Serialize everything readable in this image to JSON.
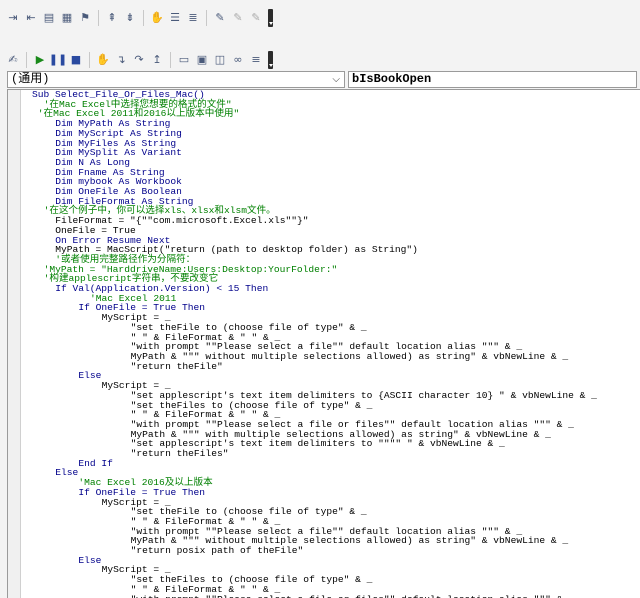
{
  "toolbar1": {
    "icons": [
      "indent-icon",
      "outdent-icon",
      "comment-icon",
      "uncomment-icon",
      "bookmark-icon",
      "prev-bookmark-icon",
      "next-bookmark-icon",
      "clear-bookmarks-icon",
      "hand-icon",
      "list-properties-icon",
      "list-constants-icon",
      "toggle-breakpoint-icon",
      "step-icon",
      "step-over-icon",
      "step-out-icon"
    ]
  },
  "toolbar2": {
    "icons": [
      "design-mode-icon",
      "run-icon",
      "break-icon",
      "reset-icon",
      "breakpoint-icon",
      "userform-icon",
      "project-explorer-icon",
      "properties-window-icon",
      "object-browser-icon",
      "toolbox-icon",
      "help-icon"
    ]
  },
  "object_combo": {
    "value": "(通用)"
  },
  "procedure_combo": {
    "value": "bIsBookOpen"
  },
  "code_lines": [
    {
      "i": 0,
      "t": "Sub Select_File_Or_Files_Mac()",
      "c": "kw"
    },
    {
      "i": 2,
      "t": "'在Mac Excel中选择您想要的格式的文件\"",
      "c": "cm"
    },
    {
      "i": 1,
      "t": "'在Mac Excel 2011和2016以上版本中使用\"",
      "c": "cm"
    },
    {
      "i": 4,
      "t": "Dim MyPath As String",
      "c": "kw"
    },
    {
      "i": 4,
      "t": "Dim MyScript As String",
      "c": "kw"
    },
    {
      "i": 4,
      "t": "Dim MyFiles As String",
      "c": "kw"
    },
    {
      "i": 4,
      "t": "Dim MySplit As Variant",
      "c": "kw"
    },
    {
      "i": 4,
      "t": "Dim N As Long",
      "c": "kw"
    },
    {
      "i": 4,
      "t": "Dim Fname As String",
      "c": "kw"
    },
    {
      "i": 4,
      "t": "Dim mybook As Workbook",
      "c": "kw"
    },
    {
      "i": 4,
      "t": "Dim OneFile As Boolean",
      "c": "kw"
    },
    {
      "i": 4,
      "t": "Dim FileFormat As String",
      "c": "kw"
    },
    {
      "i": 2,
      "t": "'在这个例子中，你可以选择xls、xlsx和xlsm文件。",
      "c": "cm"
    },
    {
      "i": 4,
      "t": "FileFormat = \"{\"\"com.microsoft.Excel.xls\"\"}\"",
      "c": ""
    },
    {
      "i": 4,
      "t": "OneFile = True",
      "c": ""
    },
    {
      "i": 4,
      "t": "On Error Resume Next",
      "c": "kw"
    },
    {
      "i": 4,
      "t": "MyPath = MacScript(\"return (path to desktop folder) as String\")",
      "c": ""
    },
    {
      "i": 4,
      "t": "'或者使用完整路径作为分隔符：",
      "c": "cm"
    },
    {
      "i": 2,
      "t": "'MyPath = \"HarddriveName:Users:Desktop:YourFolder:\"",
      "c": "cm"
    },
    {
      "i": 2,
      "t": "'构建applescript字符串，不要改变它",
      "c": "cm"
    },
    {
      "i": 4,
      "t": "If Val(Application.Version) < 15 Then",
      "c": "kw"
    },
    {
      "i": 10,
      "t": "'Mac Excel 2011",
      "c": "cm"
    },
    {
      "i": 8,
      "t": "If OneFile = True Then",
      "c": "kw"
    },
    {
      "i": 12,
      "t": "MyScript = _",
      "c": ""
    },
    {
      "i": 17,
      "t": "\"set theFile to (choose file of type\" & _",
      "c": ""
    },
    {
      "i": 17,
      "t": "\" \" & FileFormat & \" \" & _",
      "c": ""
    },
    {
      "i": 17,
      "t": "\"with prompt \"\"Please select a file\"\" default location alias \"\"\" & _",
      "c": ""
    },
    {
      "i": 17,
      "t": "MyPath & \"\"\" without multiple selections allowed) as string\" & vbNewLine & _",
      "c": ""
    },
    {
      "i": 17,
      "t": "\"return theFile\"",
      "c": ""
    },
    {
      "i": 8,
      "t": "Else",
      "c": "kw"
    },
    {
      "i": 12,
      "t": "MyScript = _",
      "c": ""
    },
    {
      "i": 17,
      "t": "\"set applescript's text item delimiters to {ASCII character 10} \" & vbNewLine & _",
      "c": ""
    },
    {
      "i": 17,
      "t": "\"set theFiles to (choose file of type\" & _",
      "c": ""
    },
    {
      "i": 17,
      "t": "\" \" & FileFormat & \" \" & _",
      "c": ""
    },
    {
      "i": 17,
      "t": "\"with prompt \"\"Please select a file or files\"\" default location alias \"\"\" & _",
      "c": ""
    },
    {
      "i": 17,
      "t": "MyPath & \"\"\" with multiple selections allowed) as string\" & vbNewLine & _",
      "c": ""
    },
    {
      "i": 17,
      "t": "\"set applescript's text item delimiters to \"\"\"\" \" & vbNewLine & _",
      "c": ""
    },
    {
      "i": 17,
      "t": "\"return theFiles\"",
      "c": ""
    },
    {
      "i": 8,
      "t": "End If",
      "c": "kw"
    },
    {
      "i": 4,
      "t": "Else",
      "c": "kw"
    },
    {
      "i": 8,
      "t": "'Mac Excel 2016及以上版本",
      "c": "cm"
    },
    {
      "i": 8,
      "t": "If OneFile = True Then",
      "c": "kw"
    },
    {
      "i": 12,
      "t": "MyScript = _",
      "c": ""
    },
    {
      "i": 17,
      "t": "\"set theFile to (choose file of type\" & _",
      "c": ""
    },
    {
      "i": 17,
      "t": "\" \" & FileFormat & \" \" & _",
      "c": ""
    },
    {
      "i": 17,
      "t": "\"with prompt \"\"Please select a file\"\" default location alias \"\"\" & _",
      "c": ""
    },
    {
      "i": 17,
      "t": "MyPath & \"\"\" without multiple selections allowed) as string\" & vbNewLine & _",
      "c": ""
    },
    {
      "i": 17,
      "t": "\"return posix path of theFile\"",
      "c": ""
    },
    {
      "i": 8,
      "t": "Else",
      "c": "kw"
    },
    {
      "i": 12,
      "t": "MyScript = _",
      "c": ""
    },
    {
      "i": 17,
      "t": "\"set theFiles to (choose file of type\" & _",
      "c": ""
    },
    {
      "i": 17,
      "t": "\" \" & FileFormat & \" \" & _",
      "c": ""
    },
    {
      "i": 17,
      "t": "\"with prompt \"\"Please select a file or files\"\" default location alias \"\"\" & _",
      "c": ""
    }
  ]
}
